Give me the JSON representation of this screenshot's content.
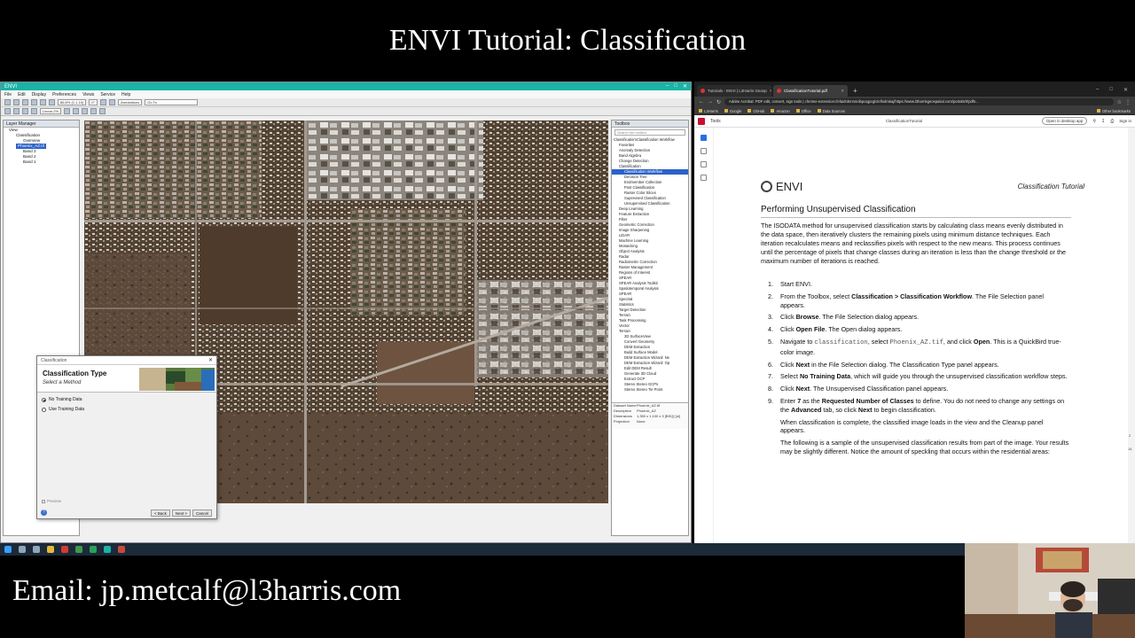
{
  "banner": {
    "title": "ENVI Tutorial: Classification"
  },
  "envi": {
    "window_title": "ENVI",
    "menu": [
      "File",
      "Edit",
      "Display",
      "Preferences",
      "Views",
      "Service",
      "Help"
    ],
    "toolbar": {
      "zoom": "86.8% (1:1.15)",
      "rotation": "0°",
      "stretch": "Linear 2%",
      "annotations": "Annotations",
      "goto": "Go To"
    },
    "layer_manager": {
      "title": "Layer Manager",
      "items": [
        "View",
        "Classification",
        "Overview",
        "Phoenix_AZ.tif",
        "Band 3",
        "Band 2",
        "Band 1"
      ]
    },
    "toolbox": {
      "title": "Toolbox",
      "search": "Search the toolbox",
      "breadcrumb": "Classification\\Classification Workflow",
      "items": [
        "Favorites",
        "Anomaly Detection",
        "Band Algebra",
        "Change Detection",
        "Classification",
        "Classification Workflow",
        "Decision Tree",
        "Endmember Collection",
        "Post Classification",
        "Raster Color Slices",
        "Supervised Classification",
        "Unsupervised Classification",
        "Deep Learning",
        "Feature Extraction",
        "Filter",
        "Geometric Correction",
        "Image Sharpening",
        "LiDAR",
        "Machine Learning",
        "Mosaicking",
        "Object Analysis",
        "Radar",
        "Radiometric Correction",
        "Raster Management",
        "Regions of Interest",
        "SPEAR",
        "SPEAR Analysis Toolkit",
        "Spatiotemporal Analysis",
        "SPEAR",
        "Spectral",
        "Statistics",
        "Target Detection",
        "Terrain",
        "Task Processing",
        "Vector",
        "Terrain",
        "3D SurfaceView",
        "Convert Geometry",
        "DEM Extraction",
        "Build Surface Model",
        "DEM Extraction Wizard: Ne",
        "DEM Extraction Wizard: Op",
        "Edit DEM Result",
        "Generate 3D Cloud",
        "Extract OCP",
        "Stereo Stereo GCPs",
        "Stereo Stereo Tie Point"
      ],
      "props": [
        {
          "k": "Dataset Name",
          "v": "Phoenix_AZ.tif"
        },
        {
          "k": "Description",
          "v": "Phoenix_AZ"
        },
        {
          "k": "Dimensions",
          "v": "1,350 x 1,100 x 3 [BSQ] [ui]"
        },
        {
          "k": "Projection",
          "v": "None"
        }
      ]
    }
  },
  "dialog": {
    "window_title": "Classification",
    "header_title": "Classification Type",
    "header_subtitle": "Select a Method",
    "options": [
      "No Training Data",
      "Use Training Data"
    ],
    "selected": 0,
    "preview": "Preview",
    "help": "?",
    "buttons": {
      "back": "< Back",
      "next": "Next >",
      "cancel": "Cancel"
    }
  },
  "chrome": {
    "tabs": [
      {
        "label": "Tutorials - ENVI | L3Harris Geosp"
      },
      {
        "label": "ClassificationTutorial.pdf"
      }
    ],
    "newtab": "+",
    "url": "chrome-extension://efaidnbmnnnibpcajpcglclefindmkaj/https://www.l3harrisgeospatial.com/portals/0/pdfs...",
    "extension_label": "Adobe Acrobat: PDF edit, convert, sign tools",
    "bookmarks": [
      "L3Harris",
      "Google",
      "GitHub",
      "Amazon",
      "Office",
      "Data Sources"
    ],
    "other_bookmarks": "Other bookmarks",
    "pdf_tools": "Tools",
    "pdf_filename": "ClassificationTutorial",
    "open_desktop": "Open in desktop app",
    "sign_in": "Sign in",
    "page_nums": [
      "2",
      "14"
    ]
  },
  "pdf": {
    "logo": "ENVI",
    "doc_tag": "Classification Tutorial",
    "section": "Performing Unsupervised Classification",
    "intro": "The ISODATA method for unsupervised classification starts by calculating class means evenly distributed in the data space, then iteratively clusters the remaining pixels using minimum distance techniques. Each iteration recalculates means and reclassifies pixels with respect to the new means. This process continues until the percentage of pixels that change classes during an iteration is less than the change threshold or the maximum number of iterations is reached.",
    "steps": [
      {
        "n": "1.",
        "html": "Start ENVI."
      },
      {
        "n": "2.",
        "html": "From the Toolbox, select <b>Classification &gt; Classification Workflow</b>. The File Selection panel appears."
      },
      {
        "n": "3.",
        "html": "Click <b>Browse</b>. The File Selection dialog appears."
      },
      {
        "n": "4.",
        "html": "Click <b>Open File</b>. The Open dialog appears."
      },
      {
        "n": "5.",
        "html": "Navigate to <span style=\"font-family:'Liberation Mono',monospace;color:#555\">classification</span>, select <span style=\"font-family:'Liberation Mono',monospace;color:#555\">Phoenix_AZ.tif</span>, and click <b>Open</b>. This is a QuickBird true-color image."
      },
      {
        "n": "6.",
        "html": "Click <b>Next</b> in the File Selection dialog. The Classification Type panel appears."
      },
      {
        "n": "7.",
        "html": "Select <b>No Training Data</b>, which will guide you through the unsupervised classification workflow steps."
      },
      {
        "n": "8.",
        "html": "Click <b>Next</b>. The Unsupervised Classification panel appears."
      },
      {
        "n": "9.",
        "html": "Enter <b>7</b> as the <b>Requested Number of Classes</b> to define. You do not need to change any settings on the <b>Advanced</b> tab, so click <b>Next</b> to begin classification."
      }
    ],
    "notes": [
      "When classification is complete, the classified image loads in the view and the Cleanup panel appears.",
      "The following is a sample of the unsupervised classification results from part of the image. Your results may be slightly different. Notice the amount of speckling that occurs within the residential areas:"
    ]
  },
  "footer": {
    "email": "Email: jp.metcalf@l3harris.com"
  }
}
